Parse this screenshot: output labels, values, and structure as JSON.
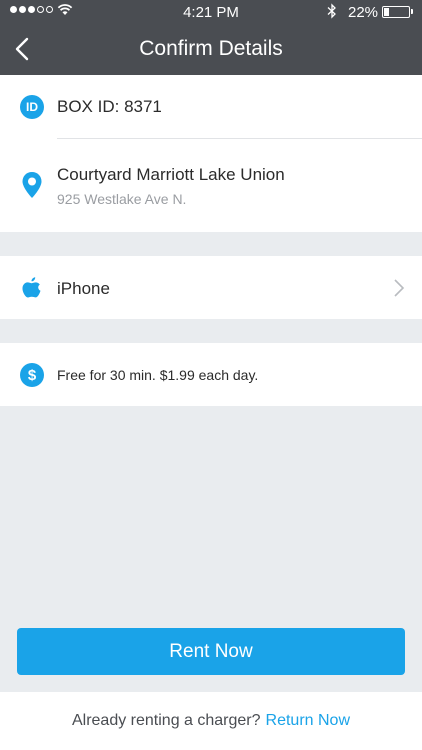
{
  "status_bar": {
    "time": "4:21 PM",
    "battery_percent": "22%",
    "battery_level": 0.22
  },
  "header": {
    "title": "Confirm Details"
  },
  "box": {
    "icon_text": "ID",
    "label": "BOX ID: 8371"
  },
  "location": {
    "name": "Courtyard Marriott Lake Union",
    "address": "925 Westlake Ave N."
  },
  "device": {
    "name": "iPhone"
  },
  "pricing": {
    "icon_text": "$",
    "text": "Free for 30 min. $1.99 each day."
  },
  "actions": {
    "rent_label": "Rent Now"
  },
  "footer": {
    "prompt": "Already renting a charger?",
    "link": "Return Now"
  },
  "colors": {
    "accent": "#1aa3e8",
    "header_bg": "#4a4d52",
    "page_bg": "#e9ecef"
  }
}
